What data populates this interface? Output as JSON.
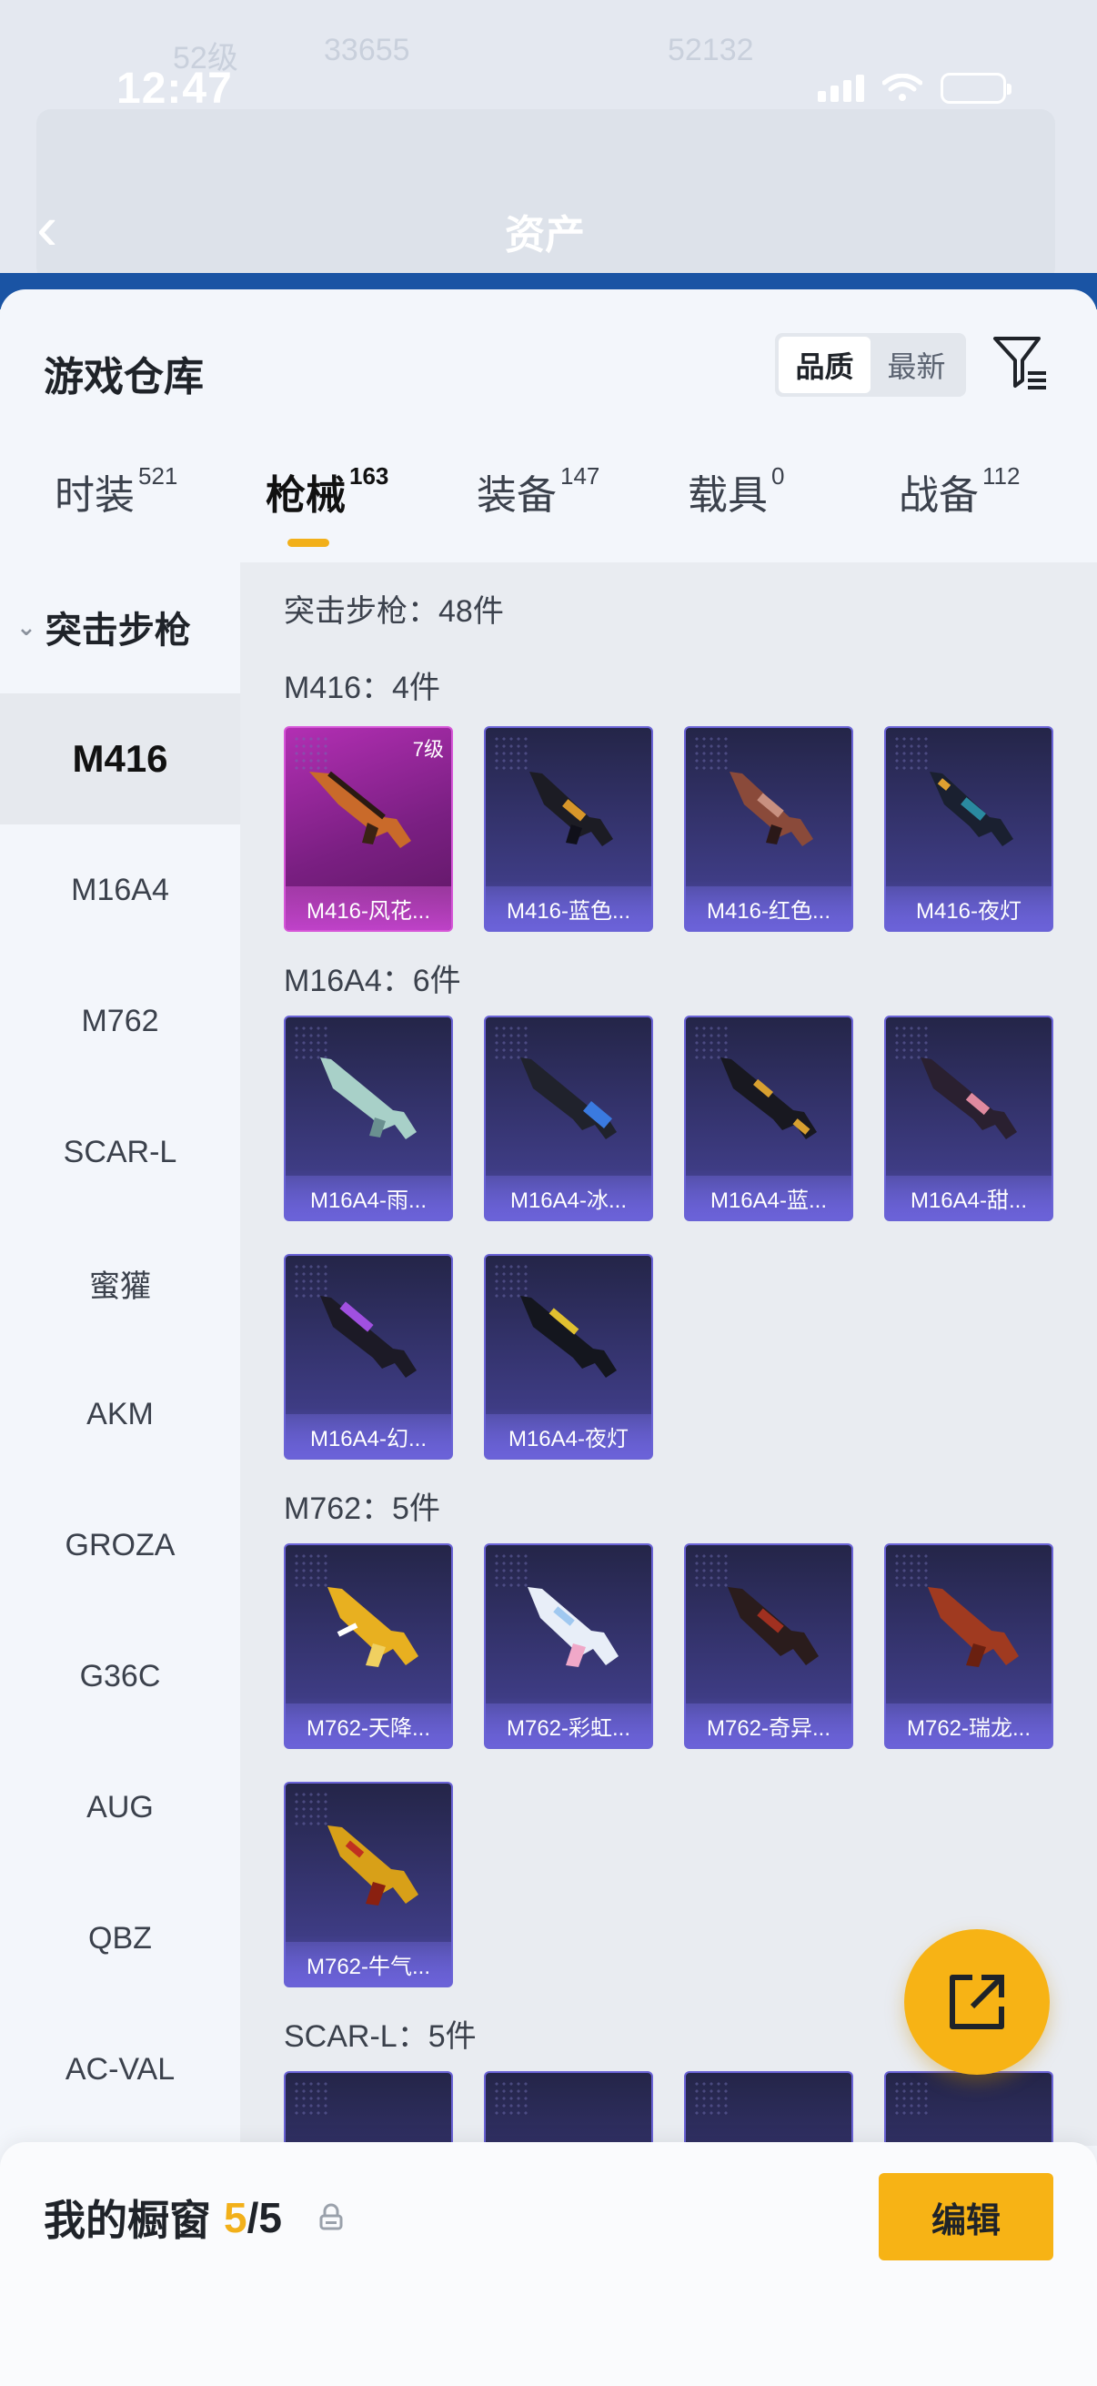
{
  "status_bar": {
    "time": "12:47"
  },
  "background": {
    "title": "资产",
    "level": "52级",
    "score1": "33655",
    "score2": "52132"
  },
  "sheet": {
    "title": "游戏仓库",
    "sort_options": [
      "品质",
      "最新"
    ],
    "active_sort": "品质"
  },
  "tabs": [
    {
      "label": "时装",
      "count": "521"
    },
    {
      "label": "枪械",
      "count": "163"
    },
    {
      "label": "装备",
      "count": "147"
    },
    {
      "label": "载具",
      "count": "0"
    },
    {
      "label": "战备",
      "count": "112"
    }
  ],
  "sidebar": {
    "category": "突击步枪",
    "items": [
      "M416",
      "M16A4",
      "M762",
      "SCAR-L",
      "蜜獾",
      "AKM",
      "GROZA",
      "G36C",
      "AUG",
      "QBZ",
      "AC-VAL"
    ]
  },
  "content": {
    "category_header": "突击步枪：48件",
    "groups": [
      {
        "header": "M416：4件",
        "cards": [
          "M416-风花...",
          "M416-蓝色...",
          "M416-红色...",
          "M416-夜灯"
        ],
        "first_level": "7级"
      },
      {
        "header": "M16A4：6件",
        "cards": [
          "M16A4-雨...",
          "M16A4-冰...",
          "M16A4-蓝...",
          "M16A4-甜...",
          "M16A4-幻...",
          "M16A4-夜灯"
        ]
      },
      {
        "header": "M762：5件",
        "cards": [
          "M762-天降...",
          "M762-彩虹...",
          "M762-奇异...",
          "M762-瑞龙...",
          "M762-牛气..."
        ]
      },
      {
        "header": "SCAR-L：5件"
      }
    ]
  },
  "bottom": {
    "label": "我的橱窗",
    "current": "5",
    "total": "/5",
    "edit_label": "编辑"
  },
  "colors": {
    "accent": "#f7b315",
    "card_blue": "#3e3c84",
    "card_pink": "#b22fb3"
  }
}
